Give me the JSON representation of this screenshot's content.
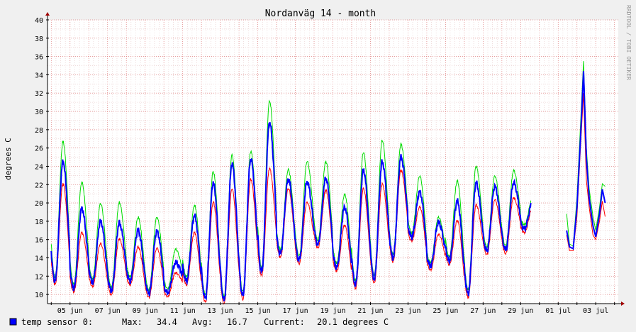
{
  "chart_data": {
    "type": "line",
    "title": "Nordanväg 14 - month",
    "ylabel": "degrees C",
    "xlabel": "",
    "watermark": "RRDTOOL / TOBI OETIKER",
    "ylim": [
      9,
      40
    ],
    "yticks": [
      10,
      12,
      14,
      16,
      18,
      20,
      22,
      24,
      26,
      28,
      30,
      32,
      34,
      36,
      38,
      40
    ],
    "xlim": [
      3.8,
      34.2
    ],
    "xticks": [
      {
        "day": 5,
        "label": "05 jun"
      },
      {
        "day": 7,
        "label": "07 jun"
      },
      {
        "day": 9,
        "label": "09 jun"
      },
      {
        "day": 11,
        "label": "11 jun"
      },
      {
        "day": 13,
        "label": "13 jun"
      },
      {
        "day": 15,
        "label": "15 jun"
      },
      {
        "day": 17,
        "label": "17 jun"
      },
      {
        "day": 19,
        "label": "19 jun"
      },
      {
        "day": 21,
        "label": "21 jun"
      },
      {
        "day": 23,
        "label": "23 jun"
      },
      {
        "day": 25,
        "label": "25 jun"
      },
      {
        "day": 27,
        "label": "27 jun"
      },
      {
        "day": 29,
        "label": "29 jun"
      },
      {
        "day": 31,
        "label": "01 jul"
      },
      {
        "day": 33,
        "label": "03 jul"
      }
    ],
    "grid": true,
    "series_style": {
      "avg": "#0000ff",
      "max": "#00dd00",
      "min": "#ff0000"
    },
    "daily_pattern": [
      {
        "day_start": 4.0,
        "min": 11.5,
        "peak": 24.5,
        "max_peak": 26.3,
        "min_peak": 22.5
      },
      {
        "day_start": 5.0,
        "min": 10.7,
        "peak": 19.4,
        "max_peak": 21.8,
        "min_peak": 17.2
      },
      {
        "day_start": 6.0,
        "min": 11.3,
        "peak": 18.0,
        "max_peak": 19.5,
        "min_peak": 16.0
      },
      {
        "day_start": 7.0,
        "min": 10.4,
        "peak": 17.8,
        "max_peak": 19.6,
        "min_peak": 16.5
      },
      {
        "day_start": 8.0,
        "min": 11.5,
        "peak": 17.0,
        "max_peak": 18.0,
        "min_peak": 15.6
      },
      {
        "day_start": 9.0,
        "min": 10.1,
        "peak": 16.9,
        "max_peak": 18.0,
        "min_peak": 15.5
      },
      {
        "day_start": 10.0,
        "min": 10.2,
        "peak": 13.5,
        "max_peak": 14.5,
        "min_peak": 12.8
      },
      {
        "day_start": 11.0,
        "min": 11.5,
        "peak": 18.6,
        "max_peak": 19.3,
        "min_peak": 17.2
      },
      {
        "day_start": 12.0,
        "min": 9.6,
        "peak": 22.2,
        "max_peak": 23.0,
        "min_peak": 20.5
      },
      {
        "day_start": 13.0,
        "min": 9.4,
        "peak": 24.3,
        "max_peak": 24.8,
        "min_peak": 22.0
      },
      {
        "day_start": 14.0,
        "min": 9.9,
        "peak": 24.8,
        "max_peak": 25.2,
        "min_peak": 23.0
      },
      {
        "day_start": 15.0,
        "min": 12.5,
        "peak": 28.8,
        "max_peak": 30.7,
        "min_peak": 24.2
      },
      {
        "day_start": 16.0,
        "min": 14.5,
        "peak": 22.6,
        "max_peak": 23.2,
        "min_peak": 22.0
      },
      {
        "day_start": 17.0,
        "min": 13.8,
        "peak": 22.3,
        "max_peak": 24.1,
        "min_peak": 20.5
      },
      {
        "day_start": 18.0,
        "min": 15.5,
        "peak": 22.7,
        "max_peak": 24.1,
        "min_peak": 21.8
      },
      {
        "day_start": 19.0,
        "min": 13.0,
        "peak": 19.5,
        "max_peak": 20.5,
        "min_peak": 18.0
      },
      {
        "day_start": 20.0,
        "min": 11.1,
        "peak": 23.6,
        "max_peak": 25.1,
        "min_peak": 22.0
      },
      {
        "day_start": 21.0,
        "min": 11.7,
        "peak": 24.5,
        "max_peak": 26.4,
        "min_peak": 22.5
      },
      {
        "day_start": 22.0,
        "min": 14.0,
        "peak": 25.0,
        "max_peak": 26.0,
        "min_peak": 24.0
      },
      {
        "day_start": 23.0,
        "min": 16.3,
        "peak": 21.2,
        "max_peak": 22.5,
        "min_peak": 20.0
      },
      {
        "day_start": 24.0,
        "min": 13.1,
        "peak": 17.9,
        "max_peak": 18.0,
        "min_peak": 17.0
      },
      {
        "day_start": 25.0,
        "min": 13.7,
        "peak": 20.2,
        "max_peak": 22.0,
        "min_peak": 18.5
      },
      {
        "day_start": 26.0,
        "min": 10.1,
        "peak": 22.2,
        "max_peak": 23.6,
        "min_peak": 20.2
      },
      {
        "day_start": 27.0,
        "min": 14.8,
        "peak": 21.8,
        "max_peak": 22.5,
        "min_peak": 20.8
      },
      {
        "day_start": 28.0,
        "min": 14.9,
        "peak": 22.2,
        "max_peak": 23.1,
        "min_peak": 21.0
      },
      {
        "day_start": 29.0,
        "min": 17.2,
        "peak": 20.0,
        "max_peak": 20.0,
        "min_peak": 19.8
      }
    ],
    "gap": [
      29.55,
      31.45
    ],
    "tail": [
      {
        "x": 31.45,
        "avg": 17.0,
        "max": 18.8,
        "min": 16.5
      },
      {
        "x": 31.6,
        "avg": 15.2,
        "max": 15.5,
        "min": 14.8
      },
      {
        "x": 31.8,
        "avg": 15.0,
        "max": 15.3,
        "min": 14.8
      },
      {
        "x": 32.0,
        "avg": 19.5,
        "max": 20.5,
        "min": 18.5
      },
      {
        "x": 32.2,
        "avg": 27.5,
        "max": 29.0,
        "min": 26.5
      },
      {
        "x": 32.35,
        "avg": 34.4,
        "max": 35.5,
        "min": 32.0
      },
      {
        "x": 32.5,
        "avg": 25.0,
        "max": 26.0,
        "min": 22.5
      },
      {
        "x": 32.65,
        "avg": 20.5,
        "max": 21.5,
        "min": 19.5
      },
      {
        "x": 32.85,
        "avg": 17.5,
        "max": 18.5,
        "min": 16.5
      },
      {
        "x": 33.0,
        "avg": 16.3,
        "max": 17.0,
        "min": 16.0
      },
      {
        "x": 33.2,
        "avg": 18.8,
        "max": 19.5,
        "min": 18.0
      },
      {
        "x": 33.35,
        "avg": 21.5,
        "max": 22.1,
        "min": 20.2
      },
      {
        "x": 33.5,
        "avg": 20.0,
        "max": 21.8,
        "min": 18.5
      }
    ]
  },
  "legend": {
    "name": "temp sensor 0:",
    "max_label": "Max:",
    "max_value": "34.4",
    "avg_label": "Avg:",
    "avg_value": "16.7",
    "current_label": "Current:",
    "current_value": "20.1 degrees C",
    "swatch_color": "#0000ff"
  }
}
